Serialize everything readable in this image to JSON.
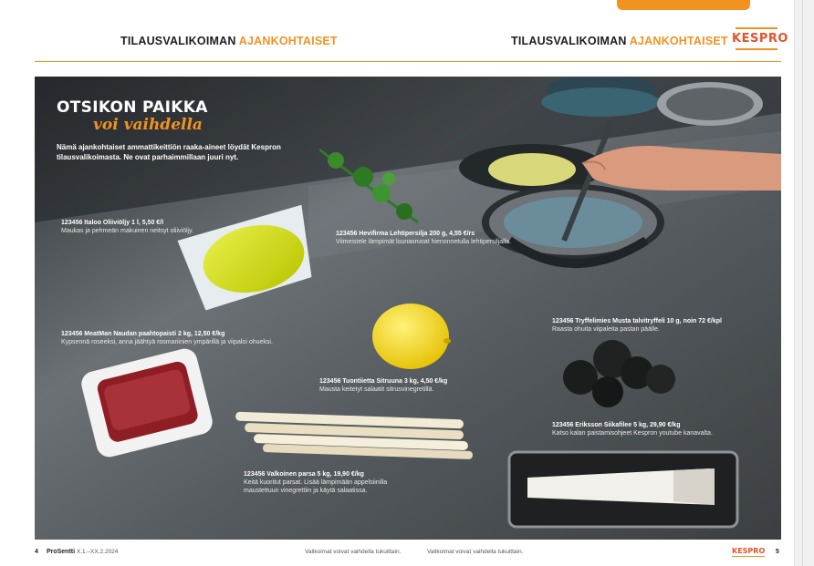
{
  "header": {
    "left_title_a": "TILAUSVALIKOIMAN",
    "left_title_b": "AJANKOHTAISET",
    "right_title_a": "TILAUSVALIKOIMAN",
    "right_title_b": "AJANKOHTAISET",
    "logo": "KESPRO"
  },
  "hero": {
    "headline": "OTSIKON PAIKKA",
    "subline": "voi vaihdella",
    "intro": "Nämä ajankohtaiset ammattikeittiön raaka-aineet löydät Kespron tilausvalikoimasta. Ne ovat parhaimmillaan juuri nyt."
  },
  "products": [
    {
      "title": "123456 Italoo Oliiviöljy 1 l, 5,50 €/l",
      "desc": "Maukas ja pehmeän makuinen neitsyt oliiviöljy."
    },
    {
      "title": "123456 Hevifirma Lehtipersilja 200 g, 4,55 €/rs",
      "desc": "Viimeistele lämpimät lounasruoat hienonnetulla lehtipersiljalla."
    },
    {
      "title": "123456 MeatMan Naudan paahtopaisti 2 kg, 12,50 €/kg",
      "desc": "Kypsennä roseeksi, anna jäähtyä rosmariinien ympärillä ja viipaloi ohueksi."
    },
    {
      "title": "123456 Tuontiietta Sitruuna 3 kg, 4,50 €/kg",
      "desc": "Mausta keitetyt salaatit sitrusvinegretillä."
    },
    {
      "title": "123456 Tryffelimies Musta talvitryffeli 10 g, noin 72 €/kpl",
      "desc": "Raasta ohuita viipaleita pastan päälle."
    },
    {
      "title": "123456 Eriksson Siikafilee 5 kg, 29,90 €/kg",
      "desc": "Katso kalan paistamisohjeet Kespron youtube kanavalta."
    },
    {
      "title": "123456 Valkoinen parsa 5 kg, 19,90 €/kg",
      "desc": "Keitä kuoritut parsat. Lisää lämpimään appelsiinilla maustettuun vinegrettiin ja käytä salaatissa."
    }
  ],
  "footer": {
    "page_left": "4",
    "brand": "ProSentti",
    "issue": "X.1.–XX.2.2024",
    "disclaimer_left": "Valikoimat voivat vaihdella tukuittain.",
    "disclaimer_right": "Valikoimat voivat vaihdella tukuittain.",
    "logo": "KESPRO",
    "page_right": "5"
  },
  "colors": {
    "accent": "#f29221",
    "logo": "#e5532a",
    "steel": "#5a5f63"
  }
}
